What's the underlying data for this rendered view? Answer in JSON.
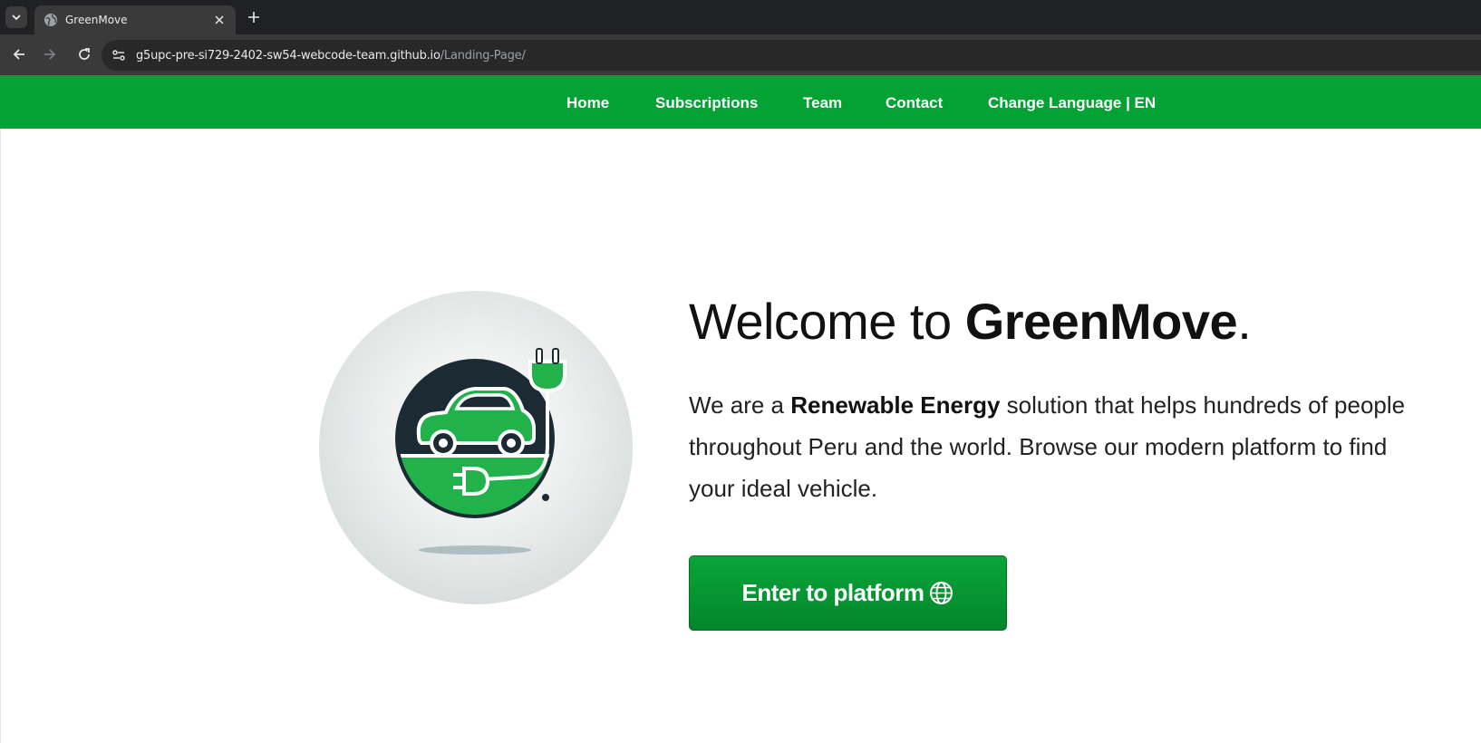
{
  "browser": {
    "tab_title": "GreenMove",
    "url_host": "g5upc-pre-si729-2402-sw54-webcode-team.github.io",
    "url_path": "/Landing-Page/"
  },
  "nav": {
    "home": "Home",
    "subscriptions": "Subscriptions",
    "team": "Team",
    "contact": "Contact",
    "language": "Change Language | EN"
  },
  "hero": {
    "headline_prefix": "Welcome to ",
    "headline_brand": "GreenMove",
    "headline_suffix": ".",
    "lead_1": "We are a ",
    "lead_bold": "Renewable Energy",
    "lead_2": " solution that helps hundreds of people throughout Peru and the world. Browse our modern platform to find your ideal vehicle.",
    "cta_label": "Enter to platform"
  },
  "colors": {
    "nav_green": "#04a135",
    "button_green": "#05962f",
    "logo_dark": "#1c2b33",
    "logo_green": "#22b24c"
  },
  "icons": [
    "chevron-down-icon",
    "globe-icon",
    "close-icon",
    "plus-icon",
    "back-icon",
    "forward-icon",
    "reload-icon",
    "site-info-icon",
    "electric-car-logo",
    "globe-icon"
  ]
}
